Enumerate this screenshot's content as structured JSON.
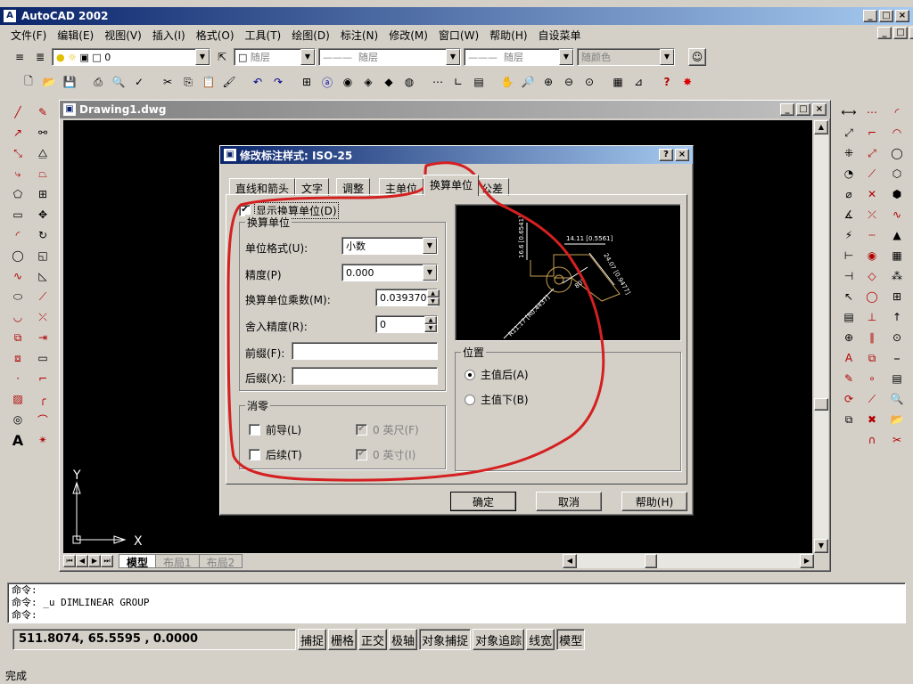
{
  "app": {
    "title": "AutoCAD 2002"
  },
  "menu": [
    "文件(F)",
    "编辑(E)",
    "视图(V)",
    "插入(I)",
    "格式(O)",
    "工具(T)",
    "绘图(D)",
    "标注(N)",
    "修改(M)",
    "窗口(W)",
    "帮助(H)",
    "自设菜单"
  ],
  "props": {
    "layer": "0",
    "color": "随层",
    "linetype": "随层",
    "lineweight": "随层",
    "plotstyle": "随颜色"
  },
  "drawing": {
    "title": "Drawing1.dwg"
  },
  "layout_tabs": [
    "模型",
    "布局1",
    "布局2"
  ],
  "dialog": {
    "title": "修改标注样式: ISO-25",
    "help_icon": "?",
    "tabs": [
      "直线和箭头",
      "文字",
      "调整",
      "主单位",
      "换算单位",
      "公差"
    ],
    "show_alt_units": "显示换算单位(D)",
    "alt_units_group": "换算单位",
    "unit_format_label": "单位格式(U):",
    "unit_format_value": "小数",
    "precision_label": "精度(P)",
    "precision_value": "0.000",
    "multiplier_label": "换算单位乘数(M):",
    "multiplier_value": "0.039370",
    "round_label": "舍入精度(R):",
    "round_value": "0",
    "prefix_label": "前缀(F):",
    "prefix_value": "",
    "suffix_label": "后缀(X):",
    "suffix_value": "",
    "zero_group": "消零",
    "leading": "前导(L)",
    "trailing": "后续(T)",
    "feet": "0 英尺(F)",
    "inches": "0 英寸(I)",
    "position_group": "位置",
    "after_primary": "主值后(A)",
    "below_primary": "主值下(B)",
    "ok": "确定",
    "cancel": "取消",
    "help": "帮助(H)",
    "preview": {
      "dim1": "14.11 [0.5561]",
      "dim2": "16.6 [0.6541]",
      "dim3": "24.07 [0.9477]",
      "dim4": "R11.17 [R0.4437]",
      "angle": "80°"
    }
  },
  "command": {
    "line1": "命令:",
    "line2": "命令: _u DIMLINEAR GROUP",
    "line3": "命令:"
  },
  "status": {
    "coords": "511.8074, 65.5595 , 0.0000",
    "toggles": [
      "捕捉",
      "栅格",
      "正交",
      "极轴",
      "对象捕捉",
      "对象追踪",
      "线宽",
      "模型"
    ],
    "ready": "完成"
  },
  "colors": {
    "annotation": "#d42020",
    "canvas": "#000000",
    "titlebar": "#0a246a"
  }
}
